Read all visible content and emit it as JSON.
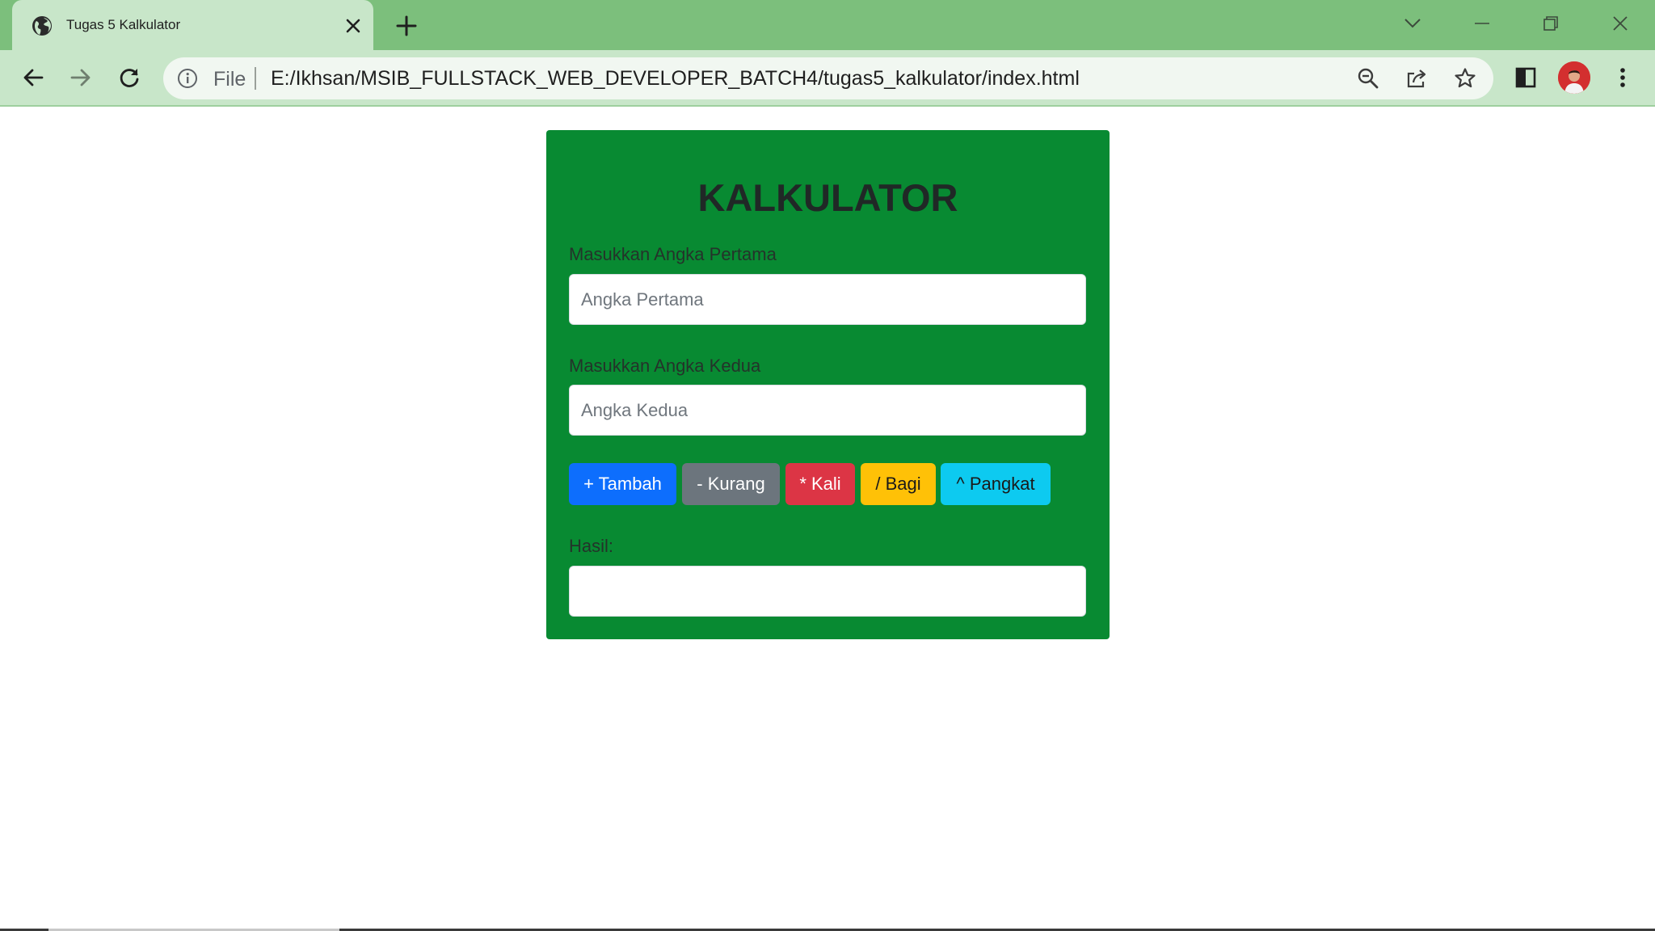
{
  "browser": {
    "tab": {
      "title": "Tugas 5 Kalkulator",
      "favicon": "globe-icon"
    },
    "address": {
      "scheme_label": "File",
      "url": "E:/Ikhsan/MSIB_FULLSTACK_WEB_DEVELOPER_BATCH4/tugas5_kalkulator/index.html"
    },
    "colors": {
      "frame": "#7cbf7c",
      "toolbar": "#c8e6c9"
    }
  },
  "page": {
    "title": "KALKULATOR",
    "first": {
      "label": "Masukkan Angka Pertama",
      "placeholder": "Angka Pertama",
      "value": ""
    },
    "second": {
      "label": "Masukkan Angka Kedua",
      "placeholder": "Angka Kedua",
      "value": ""
    },
    "buttons": {
      "add": "+ Tambah",
      "subtract": "- Kurang",
      "multiply": "* Kali",
      "divide": "/ Bagi",
      "power": "^ Pangkat"
    },
    "result": {
      "label": "Hasil:",
      "value": ""
    },
    "colors": {
      "card": "#088a32",
      "add": "#0d6efd",
      "subtract": "#6c757d",
      "multiply": "#dc3545",
      "divide": "#ffc107",
      "power": "#0dcaf0"
    }
  }
}
